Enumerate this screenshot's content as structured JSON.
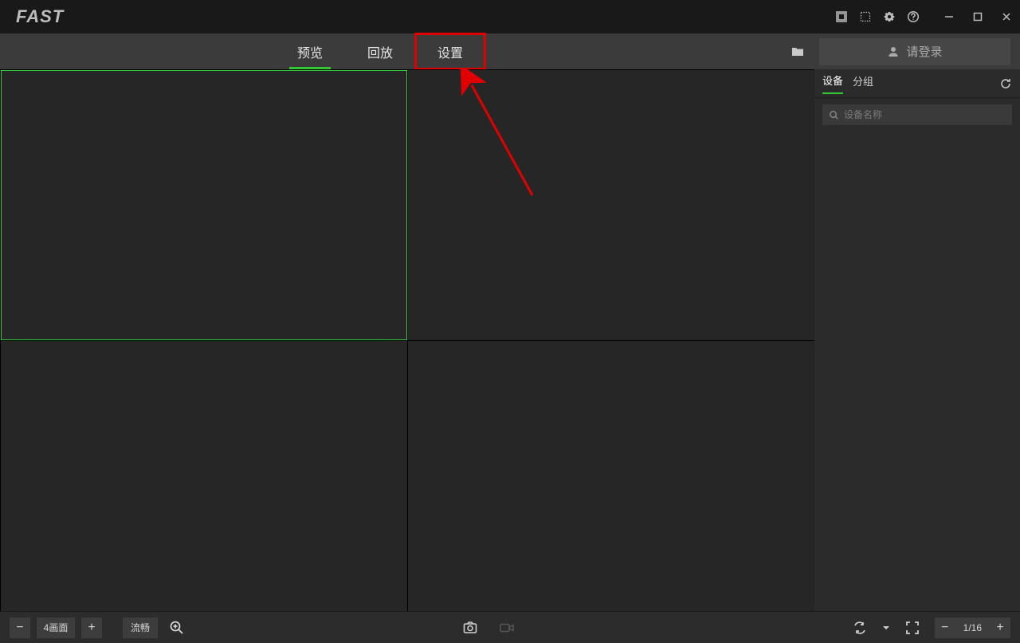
{
  "app": {
    "logo_text": "FAST"
  },
  "tabs": {
    "preview": "预览",
    "playback": "回放",
    "settings": "设置"
  },
  "login": {
    "label": "请登录"
  },
  "side": {
    "tab_device": "设备",
    "tab_group": "分组",
    "search_placeholder": "设备名称"
  },
  "bottom": {
    "layout_label": "4画面",
    "stream_label": "流畅",
    "page_label": "1/16"
  }
}
